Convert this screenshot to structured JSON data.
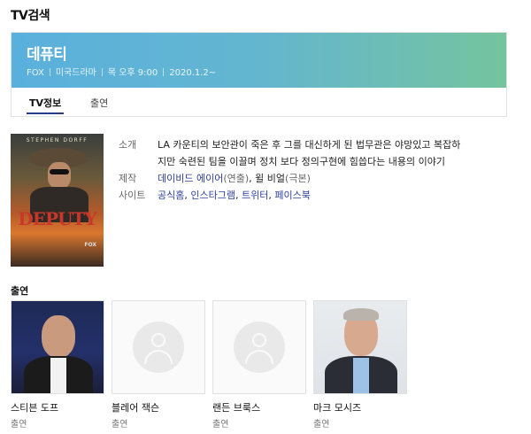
{
  "section": {
    "title": "TV검색"
  },
  "show": {
    "title": "데퓨티",
    "network": "FOX",
    "genre": "미국드라마",
    "schedule": "목 오후 9:00",
    "premiere": "2020.1.2~"
  },
  "tabs": [
    {
      "label": "TV정보",
      "active": true
    },
    {
      "label": "출연",
      "active": false
    }
  ],
  "poster": {
    "top_text": "STEPHEN DORFF",
    "title_text": "DEPUTY",
    "network_text": "FOX"
  },
  "info": {
    "synopsis_label": "소개",
    "synopsis_line1": "LA 카운티의 보안관이 죽은 후 그를 대신하게 된 법무관은 야망있고 복잡하",
    "synopsis_line2": "지만 숙련된 팀을 이끌며 정치 보다 정의구현에 힘씁다는 내용의 이야기",
    "production_label": "제작",
    "director_name": "데이비드 에이어",
    "director_role": "(연출)",
    "separator": ", ",
    "writer_name": "윌 비얼",
    "writer_role": "(극본)",
    "site_label": "사이트",
    "sites": [
      "공식홈",
      "인스타그램",
      "트위터",
      "페이스북"
    ]
  },
  "cast": {
    "title": "출연",
    "members": [
      {
        "name": "스티븐 도프",
        "role": "출연"
      },
      {
        "name": "블레어 잭슨",
        "role": "출연"
      },
      {
        "name": "랜든 브룩스",
        "role": "출연"
      },
      {
        "name": "마크 모시즈",
        "role": "출연"
      }
    ]
  },
  "colors": {
    "banner_start": "#5ab0dd",
    "banner_end": "#74c49e",
    "link": "#2c3e9b",
    "tab_underline": "#2a3c8f"
  }
}
